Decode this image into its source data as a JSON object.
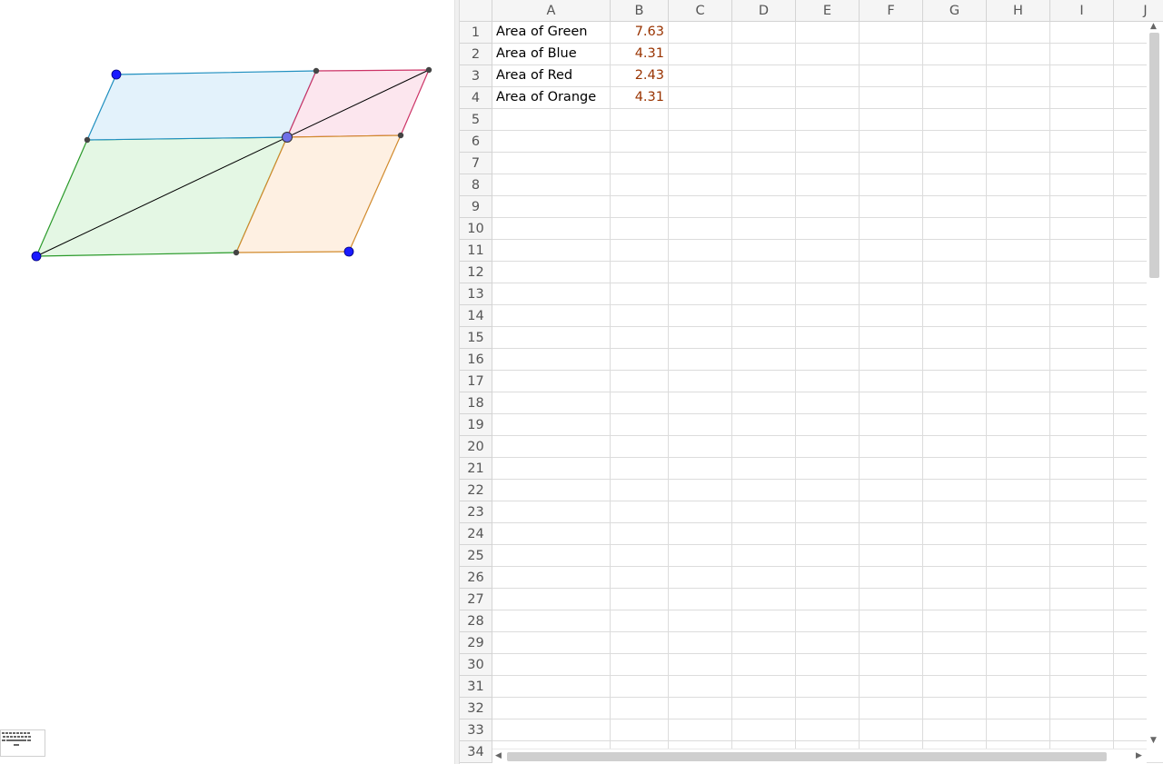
{
  "graphics": {
    "regions": [
      {
        "name": "blue-parallelogram",
        "stroke": "#1f8fbf",
        "fill": "#e3f2fb"
      },
      {
        "name": "red-parallelogram",
        "stroke": "#cc3366",
        "fill": "#fce6ee"
      },
      {
        "name": "green-parallelogram",
        "stroke": "#2a9a2a",
        "fill": "#e4f7e4"
      },
      {
        "name": "orange-parallelogram",
        "stroke": "#d18a2c",
        "fill": "#fef0e2"
      }
    ],
    "free_point_color": "#1a1aff",
    "intersection_point_color": "#6f6fe8",
    "dependent_point_color": "#444444"
  },
  "keyboard_button": {
    "icon": "keyboard-icon"
  },
  "spreadsheet": {
    "columns": [
      "A",
      "B",
      "C",
      "D",
      "E",
      "F",
      "G",
      "H",
      "I",
      "J"
    ],
    "rows": [
      "1",
      "2",
      "3",
      "4",
      "5",
      "6",
      "7",
      "8",
      "9",
      "10",
      "11",
      "12",
      "13",
      "14",
      "15",
      "16",
      "17",
      "18",
      "19",
      "20",
      "21",
      "22",
      "23",
      "24",
      "25",
      "26",
      "27",
      "28",
      "29",
      "30",
      "31",
      "32",
      "33",
      "34"
    ],
    "cells": [
      {
        "label": "Area of Green",
        "value": "7.63"
      },
      {
        "label": "Area of Blue",
        "value": "4.31"
      },
      {
        "label": "Area of Red",
        "value": "2.43"
      },
      {
        "label": "Area of Orange",
        "value": "4.31"
      }
    ],
    "value_color": "#993300",
    "header_bg": "#f5f5f5"
  }
}
